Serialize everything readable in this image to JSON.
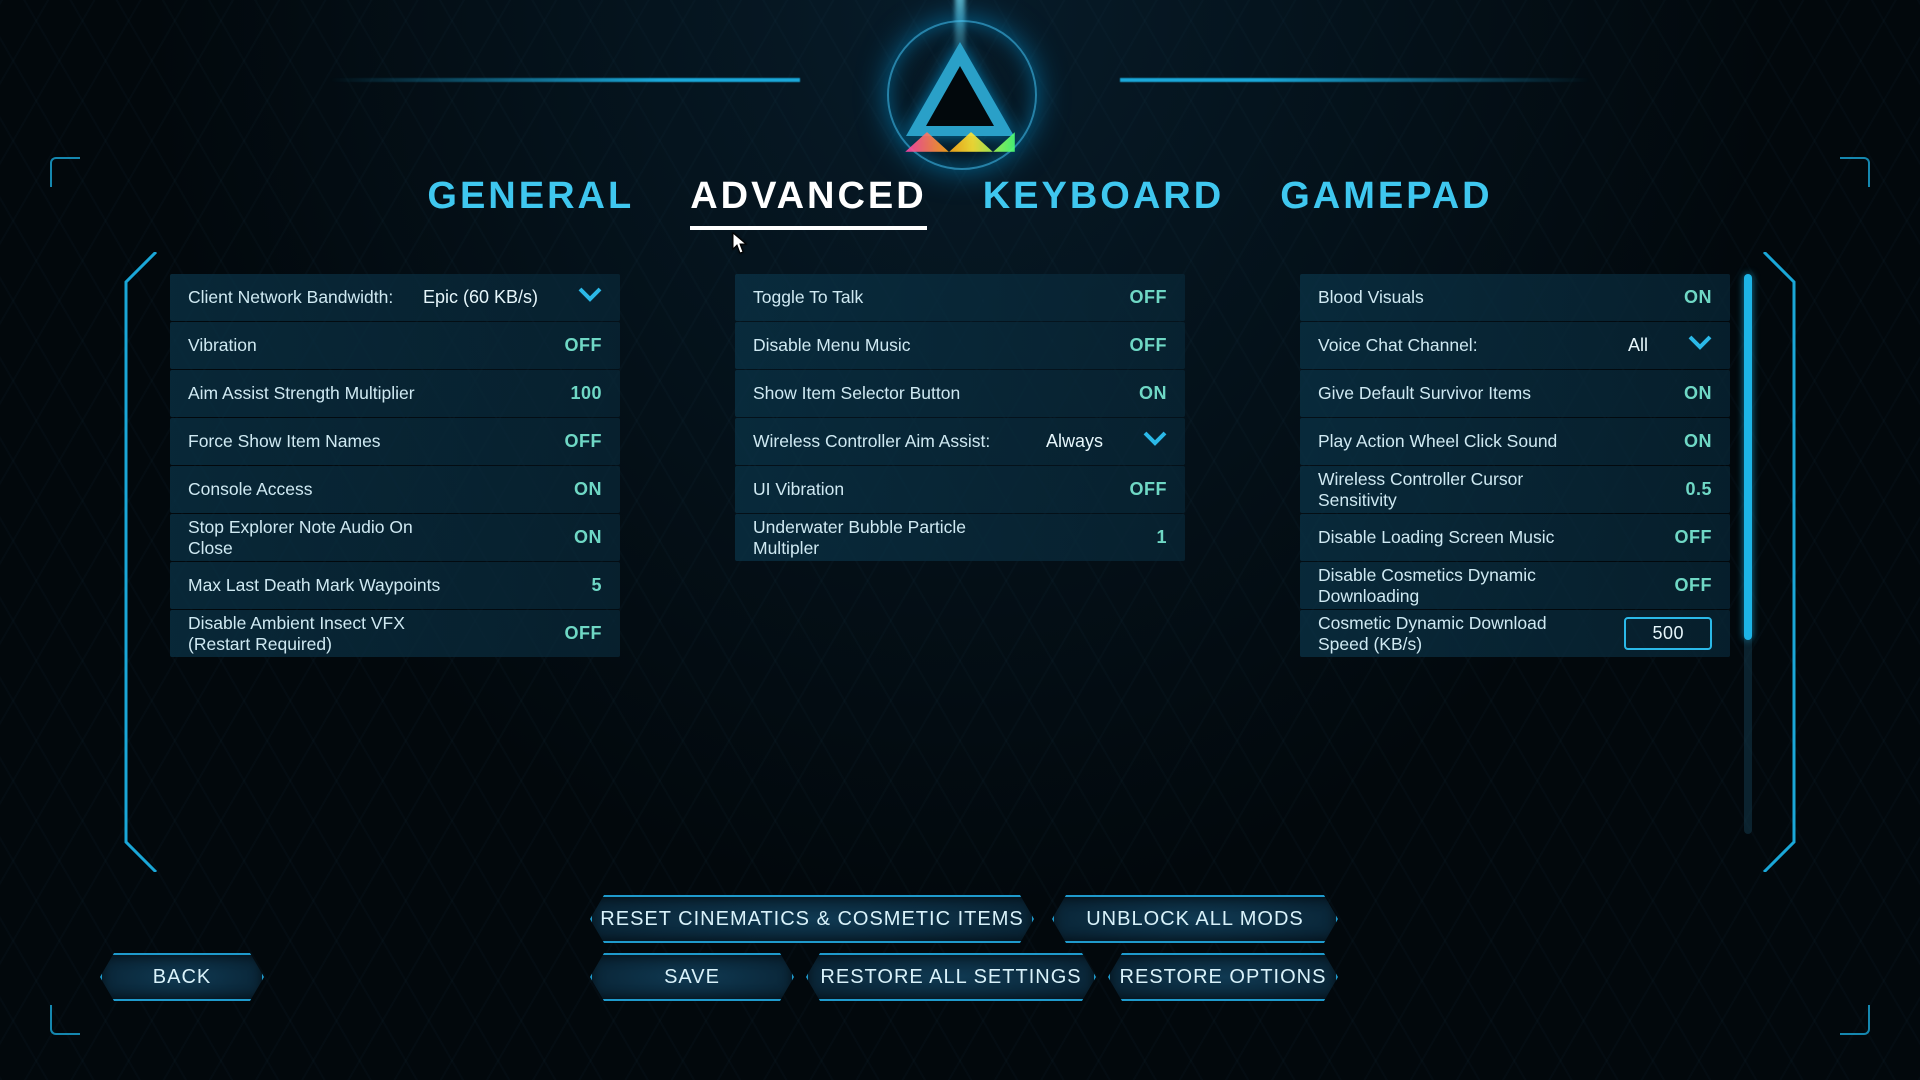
{
  "tabs": {
    "general": "GENERAL",
    "advanced": "ADVANCED",
    "keyboard": "KEYBOARD",
    "gamepad": "GAMEPAD",
    "active": "advanced"
  },
  "left": {
    "bandwidth": {
      "label": "Client Network Bandwidth:",
      "value": "Epic (60 KB/s)"
    },
    "items": [
      {
        "label": "Vibration",
        "value": "OFF"
      },
      {
        "label": "Aim Assist Strength Multiplier",
        "value": "100"
      },
      {
        "label": "Force Show Item Names",
        "value": "OFF"
      },
      {
        "label": "Console Access",
        "value": "ON"
      },
      {
        "label": "Stop Explorer Note Audio On Close",
        "value": "ON"
      },
      {
        "label": "Max Last Death Mark Waypoints",
        "value": "5"
      },
      {
        "label": "Disable Ambient Insect VFX (Restart Required)",
        "value": "OFF"
      }
    ]
  },
  "middle": {
    "items": [
      {
        "label": "Toggle To Talk",
        "value": "OFF"
      },
      {
        "label": "Disable Menu Music",
        "value": "OFF"
      },
      {
        "label": "Show Item Selector Button",
        "value": "ON"
      }
    ],
    "wcaa": {
      "label": "Wireless Controller Aim Assist:",
      "value": "Always"
    },
    "items2": [
      {
        "label": "UI Vibration",
        "value": "OFF"
      },
      {
        "label": "Underwater Bubble Particle Multipler",
        "value": "1"
      }
    ]
  },
  "right": {
    "items": [
      {
        "label": "Blood Visuals",
        "value": "ON"
      }
    ],
    "voice": {
      "label": "Voice Chat Channel:",
      "value": "All"
    },
    "items2": [
      {
        "label": "Give Default Survivor Items",
        "value": "ON"
      },
      {
        "label": "Play Action Wheel Click Sound",
        "value": "ON"
      },
      {
        "label": "Wireless Controller Cursor Sensitivity",
        "value": "0.5"
      },
      {
        "label": "Disable Loading Screen Music",
        "value": "OFF"
      },
      {
        "label": "Disable Cosmetics Dynamic Downloading",
        "value": "OFF"
      }
    ],
    "cosmetic": {
      "label": "Cosmetic Dynamic Download Speed (KB/s)",
      "value": "500"
    }
  },
  "buttons": {
    "back": "BACK",
    "save": "SAVE",
    "reset_cinematics": "RESET CINEMATICS & COSMETIC ITEMS",
    "unblock_mods": "UNBLOCK ALL MODS",
    "restore_all": "RESTORE ALL SETTINGS",
    "restore_options": "RESTORE OPTIONS"
  }
}
